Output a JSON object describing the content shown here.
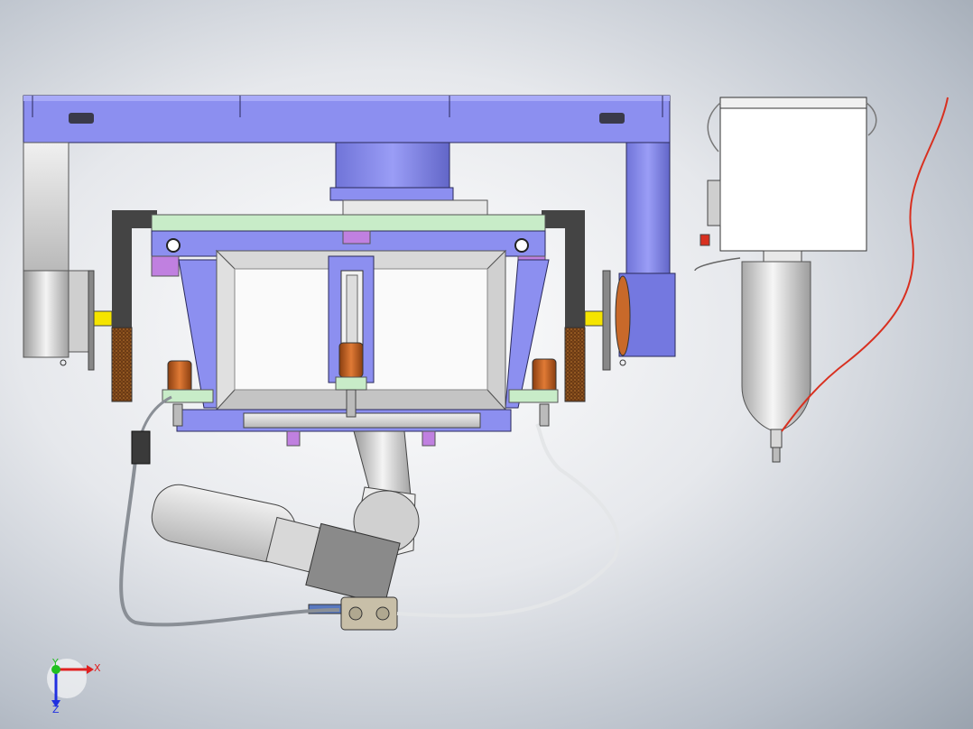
{
  "scene": {
    "colors": {
      "frame_blue": "#8c8ff0",
      "frame_blue_dark": "#6a6dd0",
      "gray_steel": "#d9d9d9",
      "orange_cylinder": "#c8692a",
      "mint_rail": "#c8ecc8",
      "yellow_tab": "#f5e400",
      "red_cable": "#d83020",
      "cable_gray": "#8a8f96"
    },
    "components": [
      {
        "id": "gantry-frame",
        "name": "gantry-frame"
      },
      {
        "id": "left-column",
        "name": "left-column"
      },
      {
        "id": "right-column",
        "name": "right-column"
      },
      {
        "id": "gripper-housing",
        "name": "gripper-housing"
      },
      {
        "id": "center-cylinder",
        "name": "center-cylinder"
      },
      {
        "id": "robot-arm",
        "name": "robot-arm"
      },
      {
        "id": "control-cabinet",
        "name": "control-cabinet"
      },
      {
        "id": "pressure-tank",
        "name": "pressure-tank"
      }
    ]
  },
  "triad": {
    "x_label": "X",
    "y_label": "Y",
    "z_label": "Z",
    "x_color": "#e02020",
    "y_color": "#20c020",
    "z_color": "#2030e0"
  }
}
